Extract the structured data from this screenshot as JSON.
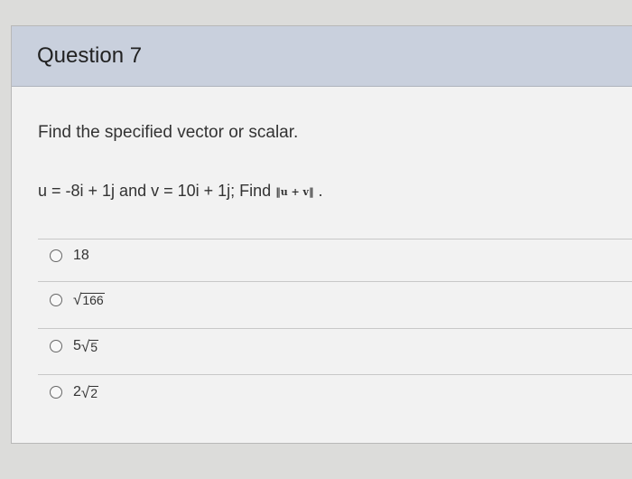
{
  "question": {
    "title": "Question 7",
    "prompt": "Find the specified vector or scalar.",
    "text_prefix": "u = -8i + 1j and v = 10i + 1j; Find",
    "norm_expr": "u + v",
    "text_suffix": "."
  },
  "options": [
    {
      "label": "18",
      "radicand": ""
    },
    {
      "coefficient": "",
      "radicand": "166"
    },
    {
      "coefficient": "5",
      "radicand": "5"
    },
    {
      "coefficient": "2",
      "radicand": "2"
    }
  ]
}
